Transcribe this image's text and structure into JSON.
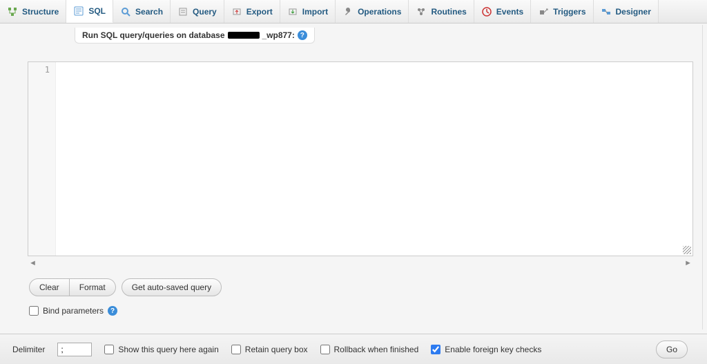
{
  "tabs": {
    "structure": "Structure",
    "sql": "SQL",
    "search": "Search",
    "query": "Query",
    "export": "Export",
    "import": "Import",
    "operations": "Operations",
    "routines": "Routines",
    "events": "Events",
    "triggers": "Triggers",
    "designer": "Designer"
  },
  "prompt": {
    "prefix": "Run SQL query/queries on database ",
    "suffix": "_wp877:"
  },
  "editor": {
    "line1": "1"
  },
  "buttons": {
    "clear": "Clear",
    "format": "Format",
    "autosaved": "Get auto-saved query"
  },
  "bind": {
    "label": "Bind parameters"
  },
  "bottom": {
    "delimiter_label": "Delimiter",
    "delimiter_value": ";",
    "show_again": "Show this query here again",
    "retain": "Retain query box",
    "rollback": "Rollback when finished",
    "fk": "Enable foreign key checks",
    "go": "Go"
  },
  "checks": {
    "show_again": false,
    "retain": false,
    "rollback": false,
    "fk": true,
    "bind": false
  }
}
